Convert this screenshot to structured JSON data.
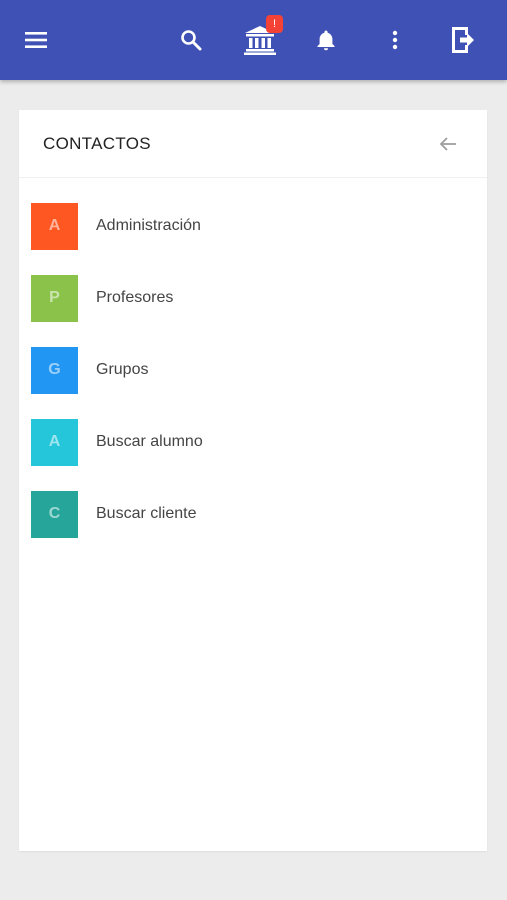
{
  "toolbar": {
    "menu_icon": "hamburger-menu-icon",
    "search_icon": "search-icon",
    "institution_icon": "bank-building-icon",
    "institution_badge": "!",
    "notifications_icon": "bell-icon",
    "more_icon": "more-vert-icon",
    "logout_icon": "logout-icon",
    "color": "#3f51b5"
  },
  "card": {
    "title": "CONTACTOS",
    "back_icon": "arrow-left-icon"
  },
  "contacts": [
    {
      "initial": "A",
      "label": "Administración",
      "color": "#ff5722"
    },
    {
      "initial": "P",
      "label": "Profesores",
      "color": "#8bc34a"
    },
    {
      "initial": "G",
      "label": "Grupos",
      "color": "#2196f3"
    },
    {
      "initial": "A",
      "label": "Buscar alumno",
      "color": "#26c6da"
    },
    {
      "initial": "C",
      "label": "Buscar cliente",
      "color": "#26a69a"
    }
  ]
}
